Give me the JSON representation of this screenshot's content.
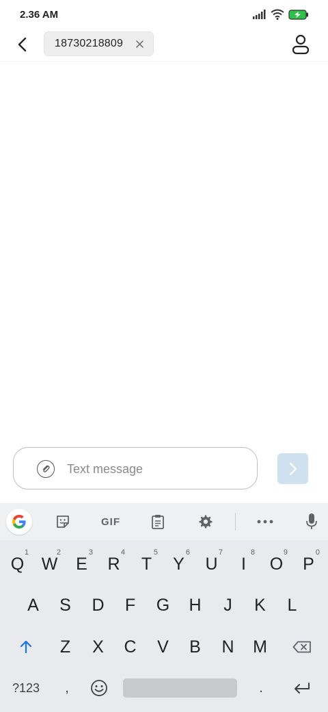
{
  "status_bar": {
    "time": "2.36 AM",
    "icons": [
      "signal-icon",
      "wifi-icon",
      "battery-charging-icon"
    ],
    "battery_color": "#2ec04a"
  },
  "header": {
    "recipient": "18730218809",
    "icons": [
      "back-arrow-icon",
      "close-icon",
      "contact-icon"
    ]
  },
  "compose": {
    "placeholder": "Text message",
    "value": "",
    "send_button_color": "#cfe0ee"
  },
  "keyboard": {
    "toolbar": {
      "gif_label": "GIF",
      "icons": [
        "google-icon",
        "sticker-icon",
        "gif-icon",
        "clipboard-icon",
        "settings-icon",
        "more-icon",
        "mic-icon"
      ]
    },
    "row1": [
      {
        "label": "Q",
        "hint": "1"
      },
      {
        "label": "W",
        "hint": "2"
      },
      {
        "label": "E",
        "hint": "3"
      },
      {
        "label": "R",
        "hint": "4"
      },
      {
        "label": "T",
        "hint": "5"
      },
      {
        "label": "Y",
        "hint": "6"
      },
      {
        "label": "U",
        "hint": "7"
      },
      {
        "label": "I",
        "hint": "8"
      },
      {
        "label": "O",
        "hint": "9"
      },
      {
        "label": "P",
        "hint": "0"
      }
    ],
    "row2": [
      "A",
      "S",
      "D",
      "F",
      "G",
      "H",
      "J",
      "K",
      "L"
    ],
    "row3": [
      "Z",
      "X",
      "C",
      "V",
      "B",
      "N",
      "M"
    ],
    "row4": {
      "symbols": "?123",
      "comma": ",",
      "period": "."
    },
    "accent_color": "#1a73e8"
  }
}
